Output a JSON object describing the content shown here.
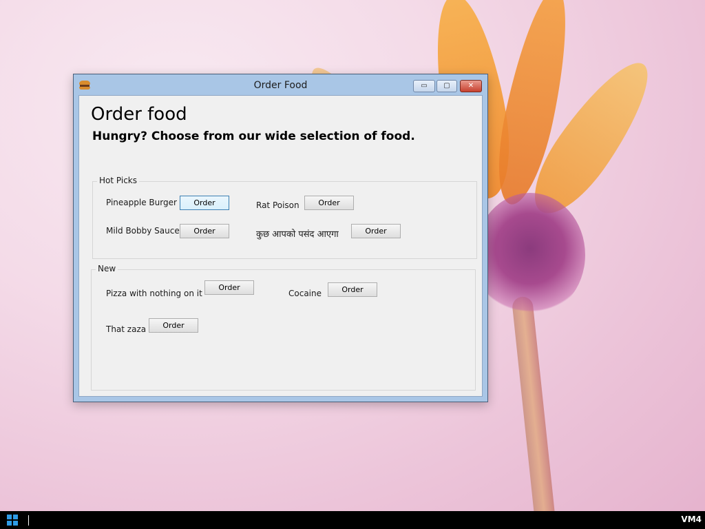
{
  "window": {
    "title": "Order Food",
    "controls": {
      "minimize": "▭",
      "maximize": "▢",
      "close": "✕"
    }
  },
  "header": {
    "heading": "Order food",
    "subheading": "Hungry? Choose from our wide selection of food."
  },
  "groups": {
    "hot_picks": {
      "label": "Hot Picks",
      "items": [
        {
          "label": "Pineapple Burger",
          "button": "Order"
        },
        {
          "label": "Rat Poison",
          "button": "Order"
        },
        {
          "label": "Mild Bobby Sauce",
          "button": "Order"
        },
        {
          "label": "कुछ आपको पसंद आएगा",
          "button": "Order"
        }
      ]
    },
    "new": {
      "label": "New",
      "items": [
        {
          "label": "Pizza with nothing on it",
          "button": "Order"
        },
        {
          "label": "Cocaine",
          "button": "Order"
        },
        {
          "label": "That zaza",
          "button": "Order"
        }
      ]
    }
  },
  "taskbar": {
    "label": "VM4"
  },
  "icons": [
    "burger-icon",
    "windows-start-icon"
  ],
  "colors": {
    "accent": "#3c7fb1",
    "title_bar": "#a9c6e6",
    "close_button": "#c7412f"
  }
}
